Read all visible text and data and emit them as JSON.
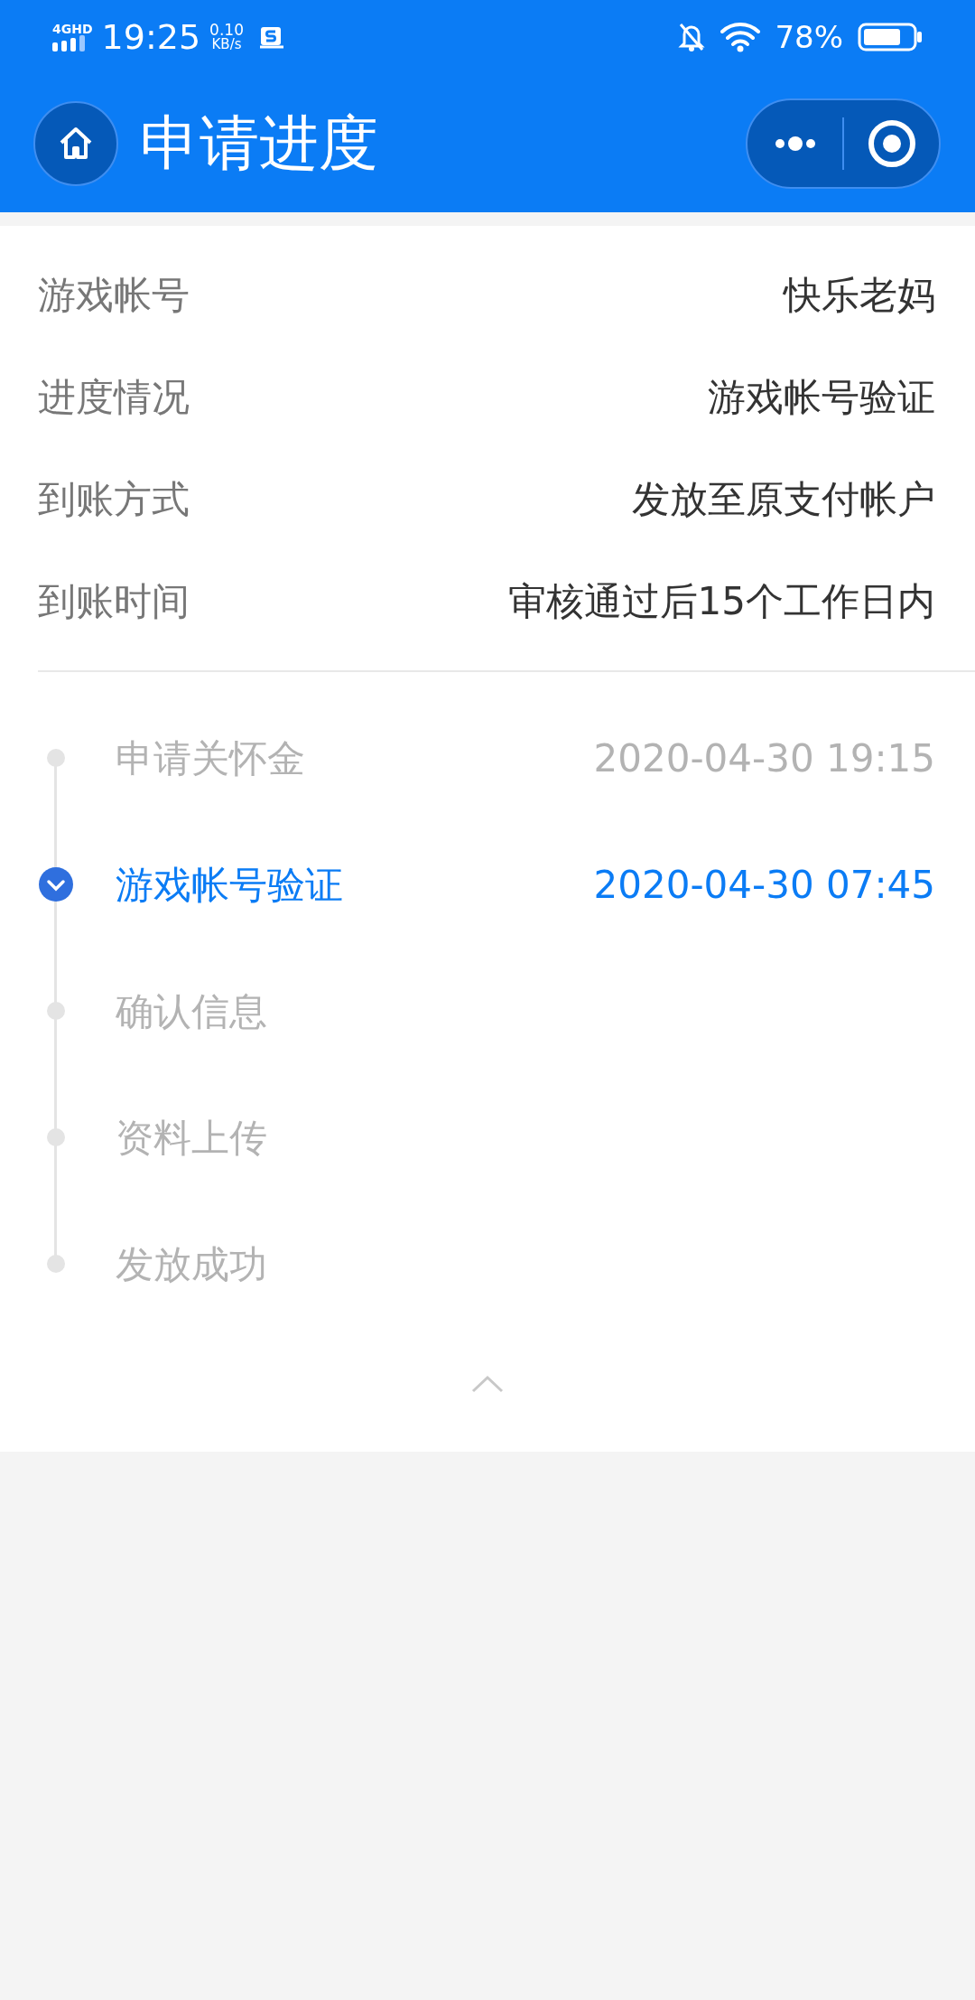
{
  "status_bar": {
    "network": "4GHD",
    "time": "19:25",
    "speed_value": "0.10",
    "speed_unit": "KB/s",
    "battery": "78%"
  },
  "header": {
    "title": "申请进度"
  },
  "details": [
    {
      "label": "游戏帐号",
      "value": "快乐老妈"
    },
    {
      "label": "进度情况",
      "value": "游戏帐号验证"
    },
    {
      "label": "到账方式",
      "value": "发放至原支付帐户"
    },
    {
      "label": "到账时间",
      "value": "审核通过后15个工作日内"
    }
  ],
  "timeline": [
    {
      "label": "申请关怀金",
      "time": "2020-04-30 19:15",
      "selected": false
    },
    {
      "label": "游戏帐号验证",
      "time": "2020-04-30 07:45",
      "selected": true
    },
    {
      "label": "确认信息",
      "selected": false
    },
    {
      "label": "资料上传",
      "selected": false
    },
    {
      "label": "发放成功",
      "selected": false
    }
  ]
}
